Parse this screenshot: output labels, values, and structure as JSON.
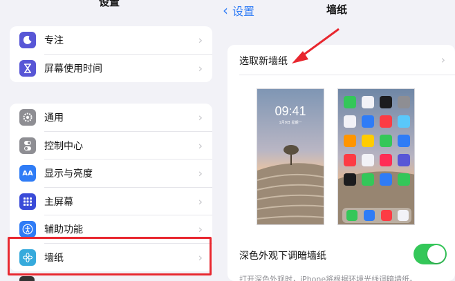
{
  "left": {
    "title": "设置",
    "group1": [
      {
        "label": "专注",
        "icon": "moon-icon",
        "color": "#5856d6"
      },
      {
        "label": "屏幕使用时间",
        "icon": "hourglass-icon",
        "color": "#5856d6"
      }
    ],
    "group2": [
      {
        "label": "通用",
        "icon": "gear-icon",
        "color": "#8e8e93"
      },
      {
        "label": "控制中心",
        "icon": "toggles-icon",
        "color": "#8e8e93"
      },
      {
        "label": "显示与亮度",
        "icon": "text-size-icon",
        "color": "#2f7cf6"
      },
      {
        "label": "主屏幕",
        "icon": "grid-icon",
        "color": "#3a4bd8"
      },
      {
        "label": "辅助功能",
        "icon": "accessibility-icon",
        "color": "#2f7cf6"
      },
      {
        "label": "墙纸",
        "icon": "flower-icon",
        "color": "#36aadc"
      }
    ]
  },
  "right": {
    "back_label": "设置",
    "title": "墙纸",
    "choose_label": "选取新墙纸",
    "lock_preview": {
      "time": "09:41",
      "date": "1月9日 星期一"
    },
    "dark_label": "深色外观下调暗墙纸",
    "dark_toggle": true,
    "footnote": "打开深色外观时，iPhone将根据环境光线调暗墙纸。"
  },
  "colors": {
    "accent": "#2f7cf6",
    "toggle_on": "#34c759",
    "highlight": "#e8272f"
  }
}
